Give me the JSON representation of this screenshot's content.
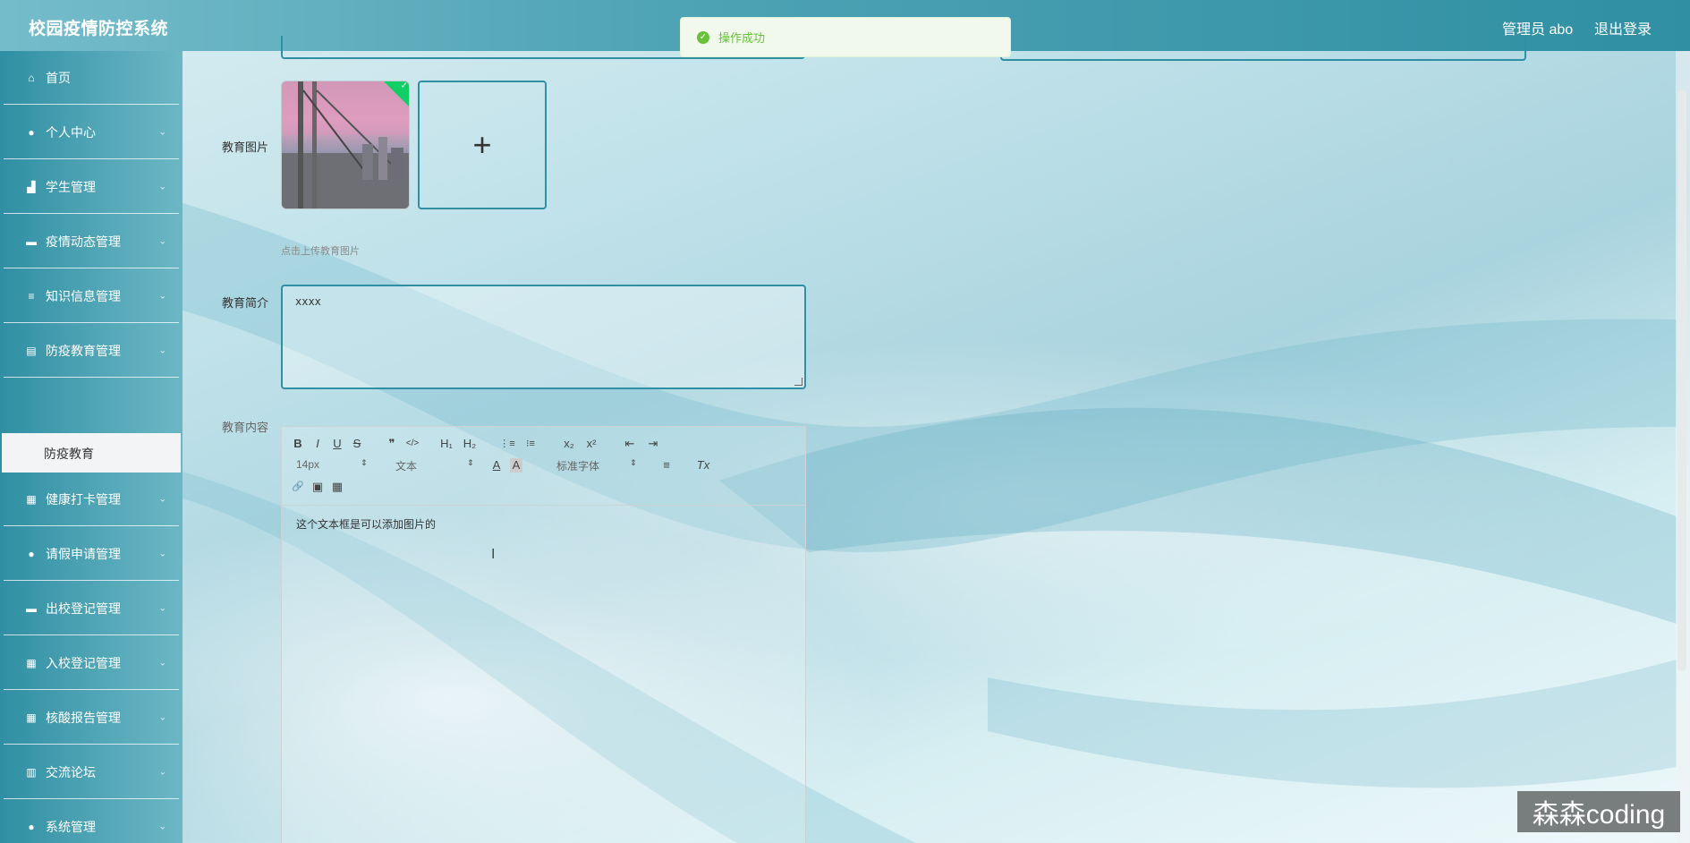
{
  "header": {
    "app_title": "校园疫情防控系统",
    "admin_label": "管理员 abo",
    "logout_label": "退出登录"
  },
  "toast": {
    "message": "操作成功",
    "icon": "check-circle-icon",
    "color": "#67c23a"
  },
  "sidebar": {
    "items": [
      {
        "label": "首页",
        "icon": "home-icon",
        "glyph": "⌂",
        "has_arrow": false
      },
      {
        "label": "个人中心",
        "icon": "user-icon",
        "glyph": "●",
        "has_arrow": true
      },
      {
        "label": "学生管理",
        "icon": "thumb-icon",
        "glyph": "▟",
        "has_arrow": true
      },
      {
        "label": "疫情动态管理",
        "icon": "monitor-icon",
        "glyph": "▬",
        "has_arrow": true
      },
      {
        "label": "知识信息管理",
        "icon": "list-icon",
        "glyph": "≡",
        "has_arrow": true
      },
      {
        "label": "防疫教育管理",
        "icon": "chart-icon",
        "glyph": "▤",
        "has_arrow": true
      },
      {
        "label": "健康打卡管理",
        "icon": "grid-icon",
        "glyph": "▦",
        "has_arrow": true
      },
      {
        "label": "请假申请管理",
        "icon": "user-icon",
        "glyph": "●",
        "has_arrow": true
      },
      {
        "label": "出校登记管理",
        "icon": "comment-icon",
        "glyph": "▬",
        "has_arrow": true
      },
      {
        "label": "入校登记管理",
        "icon": "grid-icon",
        "glyph": "▦",
        "has_arrow": true
      },
      {
        "label": "核酸报告管理",
        "icon": "grid-icon",
        "glyph": "▦",
        "has_arrow": true
      },
      {
        "label": "交流论坛",
        "icon": "bar-chart-icon",
        "glyph": "▥",
        "has_arrow": true
      },
      {
        "label": "系统管理",
        "icon": "pin-icon",
        "glyph": "●",
        "has_arrow": true
      }
    ],
    "arrow_glyph": "⌄",
    "active_submenu": "防疫教育"
  },
  "form": {
    "image_label": "教育图片",
    "upload_plus": "+",
    "upload_hint": "点击上传教育图片",
    "intro_label": "教育简介",
    "intro_value": "xxxx",
    "content_label": "教育内容",
    "editor": {
      "font_size": "14px",
      "text_style": "文本",
      "font_family": "标准字体",
      "body_text": "这个文本框是可以添加图片的",
      "select_arrow": "⇕",
      "toolbar": {
        "bold": "B",
        "italic": "I",
        "underline": "U",
        "strike": "S",
        "quote": "❞",
        "code": "</>",
        "h1": "H₁",
        "h2": "H₂",
        "ordered_list": "⋮≡",
        "bullet_list": "⁝≡",
        "subscript": "x₂",
        "superscript": "x²",
        "outdent": "⇤",
        "indent": "⇥",
        "color": "A",
        "background": "A",
        "align": "≡",
        "clean": "Tx",
        "link": "🔗",
        "image": "▣",
        "video": "▦"
      }
    }
  },
  "watermark": "森森coding"
}
